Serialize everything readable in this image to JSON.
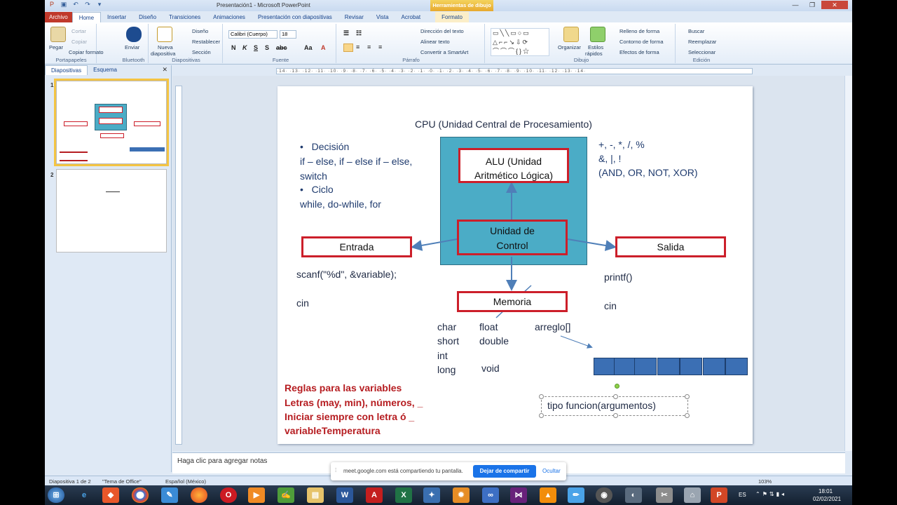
{
  "window": {
    "title": "Presentación1 - Microsoft PowerPoint",
    "context_tab": "Herramientas de dibujo",
    "buttons": [
      "—",
      "❐",
      "✕"
    ]
  },
  "tabs": [
    "Archivo",
    "Home",
    "Insertar",
    "Diseño",
    "Transiciones",
    "Animaciones",
    "Presentación con diapositivas",
    "Revisar",
    "Vista",
    "Acrobat",
    "Formato"
  ],
  "ribbon": {
    "portapapeles": {
      "label": "Portapapeles",
      "pegar": "Pegar",
      "cortar": "Cortar",
      "copiar": "Copiar",
      "copiar_formato": "Copiar formato"
    },
    "bluetooth": {
      "label": "Bluetooth",
      "enviar": "Enviar"
    },
    "diapositivas": {
      "label": "Diapositivas",
      "nueva": "Nueva",
      "nueva2": "diapositiva",
      "diseno": "Diseño",
      "restablecer": "Restablecer",
      "seccion": "Sección"
    },
    "fuente": {
      "label": "Fuente",
      "font": "Calibri (Cuerpo)",
      "size": "18"
    },
    "parrafo": {
      "label": "Párrafo",
      "direccion": "Dirección del texto",
      "alinear": "Alinear texto",
      "smartart": "Convertir a SmartArt"
    },
    "dibujo": {
      "label": "Dibujo",
      "organizar": "Organizar",
      "estilos": "Estilos",
      "rapidos": "rápidos",
      "relleno": "Relleno de forma",
      "contorno": "Contorno de forma",
      "efectos": "Efectos de forma"
    },
    "edicion": {
      "label": "Edición",
      "buscar": "Buscar",
      "reemplazar": "Reemplazar",
      "seleccionar": "Seleccionar"
    }
  },
  "left_panel": {
    "tab_slides": "Diapositivas",
    "tab_outline": "Esquema",
    "slide_numbers": [
      "1",
      "2"
    ]
  },
  "ruler": "·14· ·13· ·12· ·11· ·10· ·9· ·8· ·7· ·6· ·5· ·4· ·3· ·2· ·1· ·0· ·1· ·2· ·3· ·4· ·5· ·6· ·7· ·8· ·9· ·10· ·11· ·12· ·13· ·14·",
  "slide": {
    "title": "CPU (Unidad Central de Procesamiento)",
    "left_text": {
      "bullet1": "Decisión",
      "line1": "if – else, if – else if – else,",
      "line2": "switch",
      "bullet2": "Ciclo",
      "line3": "while, do-while, for"
    },
    "ops": [
      "+, -, *, /, %",
      "&, |,  !",
      "(AND, OR, NOT, XOR)"
    ],
    "alu": [
      "ALU (Unidad",
      "Aritmético Lógica)"
    ],
    "control": [
      "Unidad de",
      "Control"
    ],
    "entrada": "Entrada",
    "salida": "Salida",
    "memoria": "Memoria",
    "scanf": "scanf(\"%d\", &variable);",
    "cin_left": "cin",
    "printf": "printf()",
    "cin_right": "cin",
    "types_col1": [
      "char",
      "short",
      "int",
      "long"
    ],
    "types_col2": [
      "float",
      "double",
      "void"
    ],
    "arreglo": "arreglo[]",
    "rules": [
      "Reglas para  las variables",
      "Letras (may, min), números, _",
      "Iniciar siempre con letra ó _",
      "variableTemperatura"
    ],
    "funcion": "tipo funcion(argumentos)",
    "colors": {
      "cpu": "#4bacc6",
      "box_border": "#cc1f2a",
      "array_cell": "#3b6fb4"
    }
  },
  "notes_placeholder": "Haga clic para agregar notas",
  "status": {
    "slide": "Diapositiva 1 de 2",
    "theme": "\"Tema de Office\"",
    "lang": "Español (México)",
    "zoom": "103%"
  },
  "share_banner": {
    "message": "meet.google.com está compartiendo tu pantalla.",
    "stop": "Dejar de compartir",
    "hide": "Ocultar"
  },
  "taskbar": {
    "lang": "ES",
    "time": "18:01",
    "date": "02/02/2021"
  }
}
